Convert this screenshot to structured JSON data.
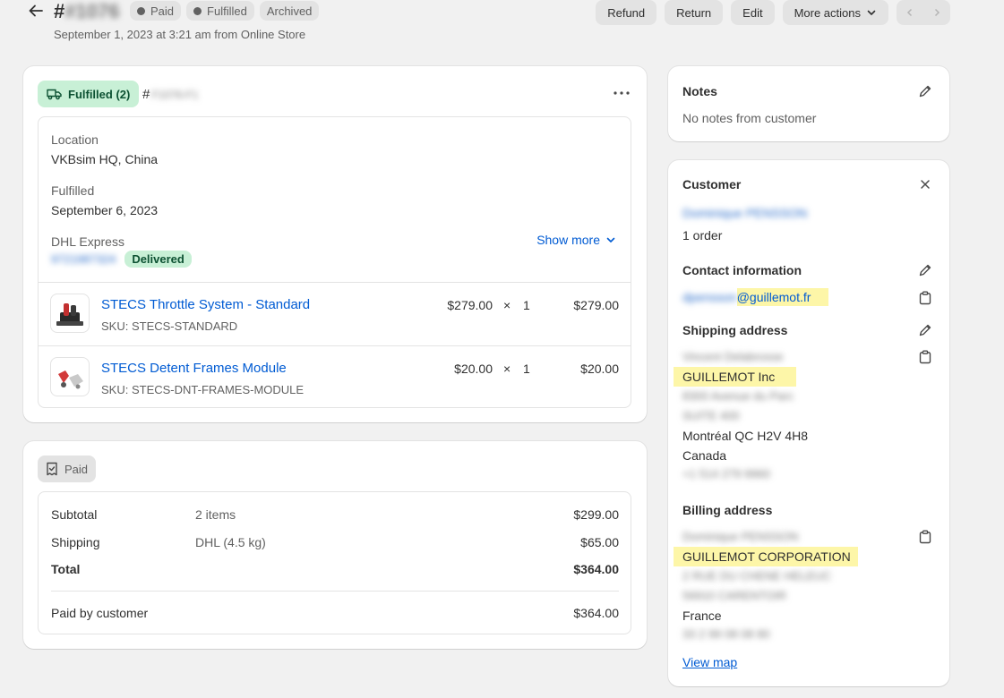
{
  "header": {
    "hash": "#",
    "order_number_blurred": "#1076",
    "badges": [
      "Paid",
      "Fulfilled",
      "Archived"
    ],
    "subtitle": "September 1, 2023 at 3:21 am from Online Store",
    "actions": {
      "refund": "Refund",
      "return": "Return",
      "edit": "Edit",
      "more": "More actions"
    }
  },
  "fulfillment": {
    "badge": "Fulfilled (2)",
    "hash": "#",
    "fulfillment_id_blurred": "F1076-F1",
    "location_label": "Location",
    "location_value": "VKBsim HQ, China",
    "fulfilled_label": "Fulfilled",
    "fulfilled_value": "September 6, 2023",
    "carrier": "DHL Express",
    "tracking_blurred": "9721987324",
    "delivered": "Delivered",
    "show_more": "Show more",
    "items": [
      {
        "name": "STECS Throttle System - Standard",
        "sku": "SKU: STECS-STANDARD",
        "price": "$279.00",
        "times": "×",
        "qty": "1",
        "total": "$279.00"
      },
      {
        "name": "STECS Detent Frames Module",
        "sku": "SKU: STECS-DNT-FRAMES-MODULE",
        "price": "$20.00",
        "times": "×",
        "qty": "1",
        "total": "$20.00"
      }
    ]
  },
  "payment": {
    "badge": "Paid",
    "subtotal_label": "Subtotal",
    "subtotal_desc": "2 items",
    "subtotal_value": "$299.00",
    "shipping_label": "Shipping",
    "shipping_desc": "DHL (4.5 kg)",
    "shipping_value": "$65.00",
    "total_label": "Total",
    "total_value": "$364.00",
    "paid_label": "Paid by customer",
    "paid_value": "$364.00"
  },
  "notes": {
    "title": "Notes",
    "text": "No notes from customer"
  },
  "customer": {
    "title": "Customer",
    "name_blurred": "Dominique PENSSON",
    "orders": "1 order",
    "contact_title": "Contact information",
    "email_blurred": "dpensson",
    "email_domain": "@guillemot.fr",
    "shipping_title": "Shipping address",
    "shipping": {
      "name_blurred": "Vincent Delabrosse",
      "company": "GUILLEMOT Inc",
      "street_blurred": "8300 Avenue du Parc",
      "suite_blurred": "SUITE 400",
      "city": "Montréal QC H2V 4H8",
      "country": "Canada",
      "phone_blurred": "+1 514 279 9960"
    },
    "billing_title": "Billing address",
    "billing": {
      "name_blurred": "Dominique PENSSON",
      "company": "GUILLEMOT CORPORATION",
      "street_blurred": "2 RUE DU CHENE HELEUC",
      "city_blurred": "56910 CARENTOIR",
      "country": "France",
      "phone_blurred": "33 2 99 08 08 80"
    },
    "view_map": "View map"
  },
  "colors": {
    "link": "#005bd3",
    "success_bg": "#c8f0d6",
    "highlight": "#fdf6a8"
  }
}
